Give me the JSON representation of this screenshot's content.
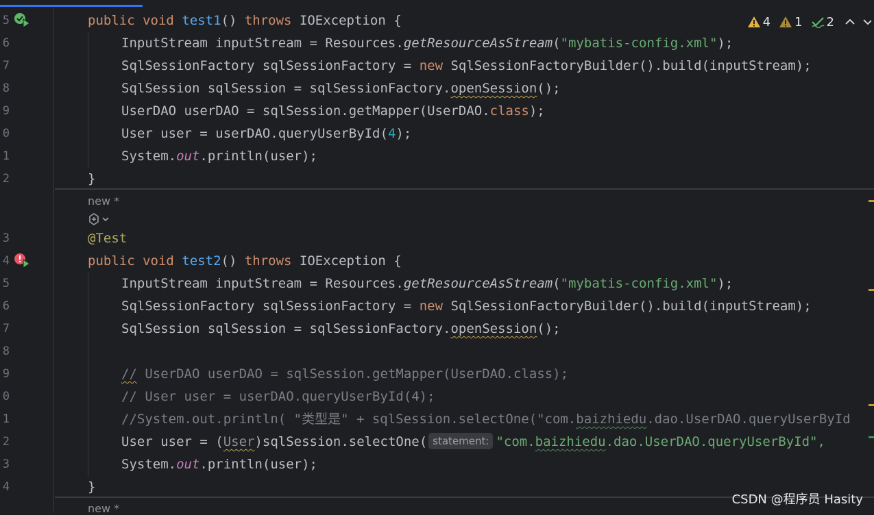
{
  "line_numbers": [
    "5",
    "6",
    "7",
    "8",
    "9",
    "0",
    "1",
    "2",
    "3",
    "4",
    "5",
    "6",
    "7",
    "8",
    "9",
    "0",
    "1",
    "2",
    "3",
    "4"
  ],
  "status": {
    "warnings": "4",
    "weak_warnings": "1",
    "typos": "2"
  },
  "lens": {
    "new_label": "new *"
  },
  "code": {
    "m1": {
      "public": "public",
      "void": "void",
      "name": "test1",
      "paren": "() ",
      "throws": "throws",
      "rest": " IOException {"
    },
    "l1": {
      "a": "InputStream inputStream = Resources.",
      "b": "getResourceAsStream",
      "c": "(",
      "d": "\"mybatis-config.xml\"",
      "e": ");"
    },
    "l2": {
      "a": "SqlSessionFactory sqlSessionFactory = ",
      "b": "new",
      "c": " SqlSessionFactoryBuilder().build(inputStream);"
    },
    "l3": {
      "a": "SqlSession sqlSession = sqlSessionFactory.",
      "b": "openSession",
      "c": "();"
    },
    "l4": {
      "a": "UserDAO userDAO = sqlSession.getMapper(UserDAO.",
      "b": "class",
      "c": ");"
    },
    "l5": {
      "a": "User user = userDAO.queryUserById(",
      "b": "4",
      "c": ");"
    },
    "l6": {
      "a": "System.",
      "b": "out",
      "c": ".println(user);"
    },
    "close1": "}",
    "anno": "@Test",
    "m2": {
      "public": "public",
      "void": "void",
      "name": "test2",
      "paren": "() ",
      "throws": "throws",
      "rest": " IOException {"
    },
    "c1": {
      "a": "//",
      "b": " UserDAO userDAO = sqlSession.getMapper(UserDAO.class);"
    },
    "c2": "// User user = userDAO.queryUserById(4);",
    "c3": {
      "a": "//System.out.println( \"类型是\" + sqlSession.selectOne(\"com.",
      "b": "baizhiedu",
      "c": ".dao.UserDAO.queryUserById"
    },
    "l10": {
      "a": "User user = (",
      "b": "User",
      "c": ")sqlSession.selectOne(",
      "hint": "statement:",
      "d": "\"com.",
      "e": "baizhiedu",
      "f": ".dao.UserDAO.queryUserById\","
    },
    "close2": "}"
  },
  "watermark": "CSDN @程序员 Hasity"
}
